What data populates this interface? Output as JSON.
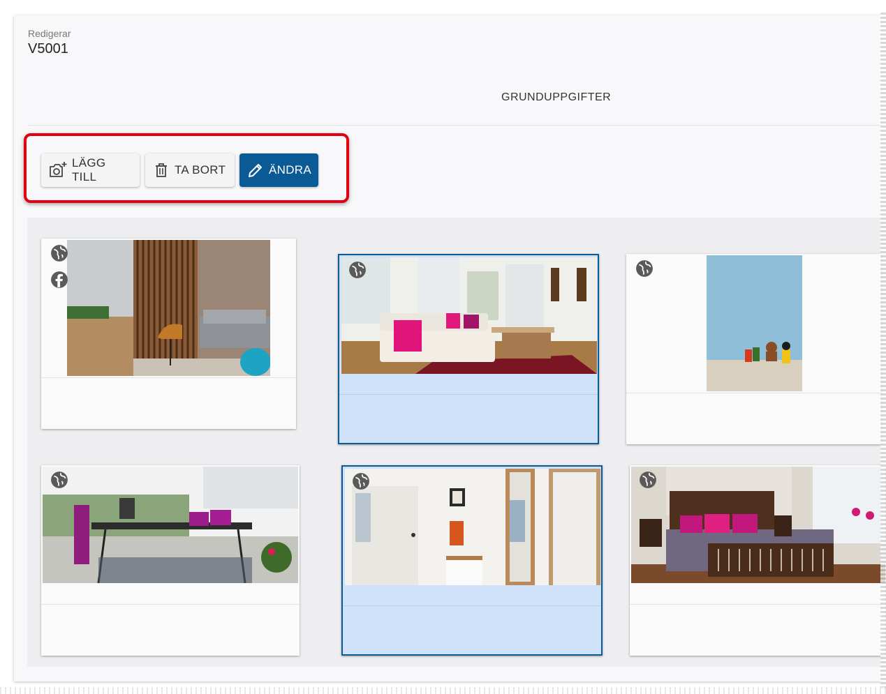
{
  "header": {
    "editing_label": "Redigerar",
    "record_id": "V5001",
    "section_title": "GRUNDUPPGIFTER"
  },
  "toolbar": {
    "add_label": "LÄGG TILL",
    "remove_label": "TA BORT",
    "edit_label": "ÄNDRA"
  },
  "colors": {
    "primary": "#0a5a96",
    "selected_bg": "#cfe2f9",
    "annotation_red": "#e00012"
  },
  "gallery": {
    "images": [
      {
        "scene": "office lounge with wood slat wall",
        "icons": [
          "globe-icon",
          "facebook-icon"
        ],
        "selected": false
      },
      {
        "scene": "living room with white sofa and pink blanket",
        "icons": [
          "globe-icon"
        ],
        "selected": true
      },
      {
        "scene": "empty room with blue wall and toys",
        "icons": [
          "globe-icon"
        ],
        "selected": false
      },
      {
        "scene": "balcony with table and purple chairs",
        "icons": [
          "globe-icon"
        ],
        "selected": false
      },
      {
        "scene": "hallway with white door and mirror",
        "icons": [
          "globe-icon"
        ],
        "selected": true
      },
      {
        "scene": "bedroom with dark wood bed and pink pillows",
        "icons": [
          "globe-icon"
        ],
        "selected": false
      }
    ]
  }
}
